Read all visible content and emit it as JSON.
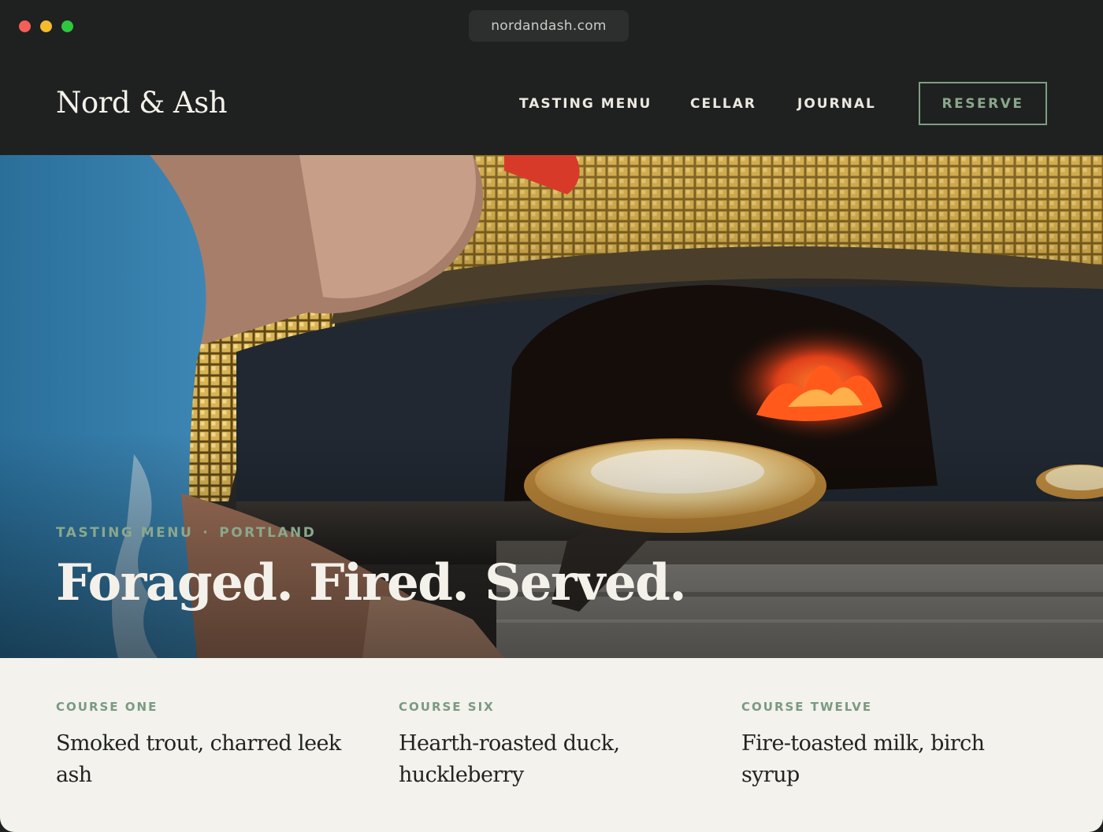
{
  "browser": {
    "url": "nordandash.com"
  },
  "header": {
    "logo": "Nord & Ash",
    "nav": [
      "TASTING MENU",
      "CELLAR",
      "JOURNAL"
    ],
    "reserve_label": "RESERVE"
  },
  "hero": {
    "eyebrow_left": "TASTING MENU",
    "eyebrow_sep": "·",
    "eyebrow_right": "PORTLAND",
    "headline": "Foraged. Fired. Served.",
    "image": "chef-sliding-pizza-into-wood-fired-oven"
  },
  "courses": [
    {
      "label": "COURSE ONE",
      "dish": "Smoked trout, charred leek ash"
    },
    {
      "label": "COURSE SIX",
      "dish": "Hearth-roasted duck, huckleberry"
    },
    {
      "label": "COURSE TWELVE",
      "dish": "Fire-toasted milk, birch syrup"
    }
  ],
  "colors": {
    "background_dark": "#1f2120",
    "accent_sage": "#8aa88c",
    "course_panel": "#f3f2ed",
    "text_light": "#f4f1ea"
  }
}
